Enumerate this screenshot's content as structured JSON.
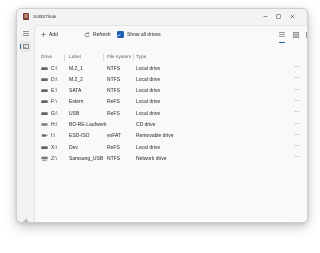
{
  "app": {
    "title": "SUBSTitute"
  },
  "toolbar": {
    "add_label": "Add",
    "refresh_label": "Refresh",
    "show_all_label": "Show all drives"
  },
  "table": {
    "columns": [
      "Drive",
      "Label",
      "File system",
      "Type"
    ],
    "rows": [
      {
        "drive": "C:\\",
        "label": "M.2_1",
        "fs": "NTFS",
        "type": "Local drive",
        "icon": "drive-icon"
      },
      {
        "drive": "D:\\",
        "label": "M.2_2",
        "fs": "NTFS",
        "type": "Local drive",
        "icon": "drive-icon"
      },
      {
        "drive": "E:\\",
        "label": "SATA",
        "fs": "NTFS",
        "type": "Local drive",
        "icon": "drive-icon"
      },
      {
        "drive": "F:\\",
        "label": "Extern",
        "fs": "ReFS",
        "type": "Local drive",
        "icon": "drive-icon"
      },
      {
        "drive": "G:\\",
        "label": "USB",
        "fs": "ReFS",
        "type": "Local drive",
        "icon": "drive-icon"
      },
      {
        "drive": "H:\\",
        "label": "BD-RE-Laufwerk",
        "fs": "",
        "type": "CD drive",
        "icon": "optical-drive-icon"
      },
      {
        "drive": "I:\\",
        "label": "ESD-ISO",
        "fs": "exFAT",
        "type": "Removable drive",
        "icon": "usb-drive-icon"
      },
      {
        "drive": "X:\\",
        "label": "Dev",
        "fs": "ReFS",
        "type": "Local drive",
        "icon": "drive-icon"
      },
      {
        "drive": "Z:\\",
        "label": "Samsung_USB",
        "fs": "NTFS",
        "type": "Network drive",
        "icon": "network-drive-icon"
      }
    ],
    "more_label": "···"
  },
  "colors": {
    "accent": "#1a5fb4",
    "window_bg": "#f3f3f3",
    "content_bg": "#f9f9f9"
  }
}
